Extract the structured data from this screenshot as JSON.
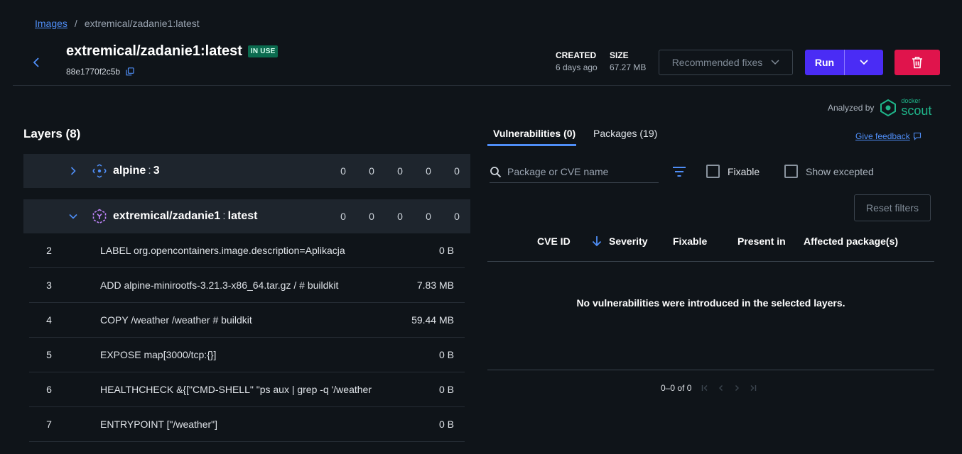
{
  "breadcrumb": {
    "root": "Images",
    "separator": "/",
    "current": "extremical/zadanie1:latest"
  },
  "header": {
    "title": "extremical/zadanie1:latest",
    "badge": "IN USE",
    "digest": "88e1770f2c5b",
    "created_label": "CREATED",
    "created_value": "6 days ago",
    "size_label": "SIZE",
    "size_value": "67.27 MB",
    "recommended_fixes": "Recommended fixes",
    "run_label": "Run"
  },
  "analyzed": {
    "label": "Analyzed by",
    "logo_small": "docker",
    "logo_big": "scout"
  },
  "layers": {
    "title": "Layers (8)",
    "base_image": {
      "name": "alpine",
      "sep": ":",
      "tag": "3",
      "counts": [
        "0",
        "0",
        "0",
        "0",
        "0"
      ]
    },
    "own_image": {
      "name": "extremical/zadanie1",
      "sep": ":",
      "tag": "latest",
      "counts": [
        "0",
        "0",
        "0",
        "0",
        "0"
      ]
    },
    "rows": [
      {
        "num": "2",
        "cmd": "LABEL org.opencontainers.image.description=Aplikacja",
        "size": "0 B"
      },
      {
        "num": "3",
        "cmd": "ADD alpine-minirootfs-3.21.3-x86_64.tar.gz / # buildkit",
        "size": "7.83 MB"
      },
      {
        "num": "4",
        "cmd": "COPY /weather /weather # buildkit",
        "size": "59.44 MB"
      },
      {
        "num": "5",
        "cmd": "EXPOSE map[3000/tcp:{}]",
        "size": "0 B"
      },
      {
        "num": "6",
        "cmd": "HEALTHCHECK &{[\"CMD-SHELL\" \"ps aux | grep -q '/weather",
        "size": "0 B"
      },
      {
        "num": "7",
        "cmd": "ENTRYPOINT [\"/weather\"]",
        "size": "0 B"
      }
    ]
  },
  "panel": {
    "tab_vulns": "Vulnerabilities (0)",
    "tab_packages": "Packages (19)",
    "feedback": "Give feedback",
    "search_placeholder": "Package or CVE name",
    "fixable": "Fixable",
    "show_excepted": "Show excepted",
    "reset_filters": "Reset filters",
    "columns": {
      "cve": "CVE ID",
      "severity": "Severity",
      "fixable": "Fixable",
      "present": "Present in",
      "affected": "Affected package(s)"
    },
    "empty": "No vulnerabilities were introduced in the selected layers.",
    "pager": "0–0 of 0"
  },
  "colors": {
    "accent": "#4f8ef7",
    "run": "#4a2cf5",
    "delete": "#e0144c",
    "badge": "#0b6b4f",
    "scout": "#1fb58a"
  }
}
